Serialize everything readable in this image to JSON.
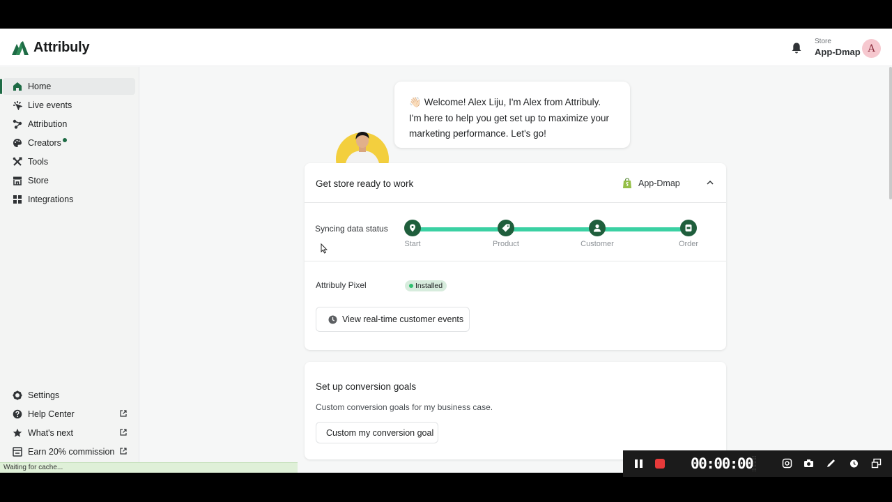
{
  "app": {
    "brand": "Attribuly"
  },
  "header": {
    "store_caption": "Store",
    "store_name": "App-Dmap",
    "avatar_initial": "A"
  },
  "sidebar": {
    "items": [
      {
        "label": "Home",
        "icon": "home-icon",
        "active": true
      },
      {
        "label": "Live events",
        "icon": "live-events-icon"
      },
      {
        "label": "Attribution",
        "icon": "attribution-icon"
      },
      {
        "label": "Creators",
        "icon": "palette-icon",
        "has_dot": true
      },
      {
        "label": "Tools",
        "icon": "tools-icon"
      },
      {
        "label": "Store",
        "icon": "store-icon"
      },
      {
        "label": "Integrations",
        "icon": "grid-icon"
      }
    ],
    "bottom_items": [
      {
        "label": "Settings",
        "icon": "gear-icon"
      },
      {
        "label": "Help Center",
        "icon": "help-icon",
        "external": true
      },
      {
        "label": "What's next",
        "icon": "star-icon",
        "external": true
      },
      {
        "label": "Earn 20% commission",
        "icon": "gift-icon",
        "external": true
      }
    ]
  },
  "status_bar": {
    "text": "Waiting for cache..."
  },
  "welcome": {
    "emoji": "👋🏻",
    "line1": "Welcome! Alex Liju, I'm Alex from Attribuly.",
    "line2": "I'm here to help you get set up to maximize your",
    "line3": "marketing performance. Let's go!"
  },
  "setup_card": {
    "title": "Get store ready to work",
    "store_tag": "App-Dmap",
    "sync_label": "Syncing data status",
    "steps": [
      {
        "label": "Start",
        "icon": "location-pin-icon"
      },
      {
        "label": "Product",
        "icon": "tag-icon"
      },
      {
        "label": "Customer",
        "icon": "person-icon"
      },
      {
        "label": "Order",
        "icon": "receipt-icon"
      }
    ],
    "pixel_label": "Attribuly Pixel",
    "pixel_status": "Installed",
    "events_button": "View real-time customer events"
  },
  "goals_card": {
    "title": "Set up conversion goals",
    "subtitle": "Custom conversion goals for my business case.",
    "button": "Custom my conversion goal"
  },
  "recorder": {
    "timer": "00:00:00"
  },
  "colors": {
    "brand_green": "#1e6b45",
    "track": "#3bd1a3",
    "step": "#1f5e3c",
    "record_red": "#e73a3a"
  }
}
